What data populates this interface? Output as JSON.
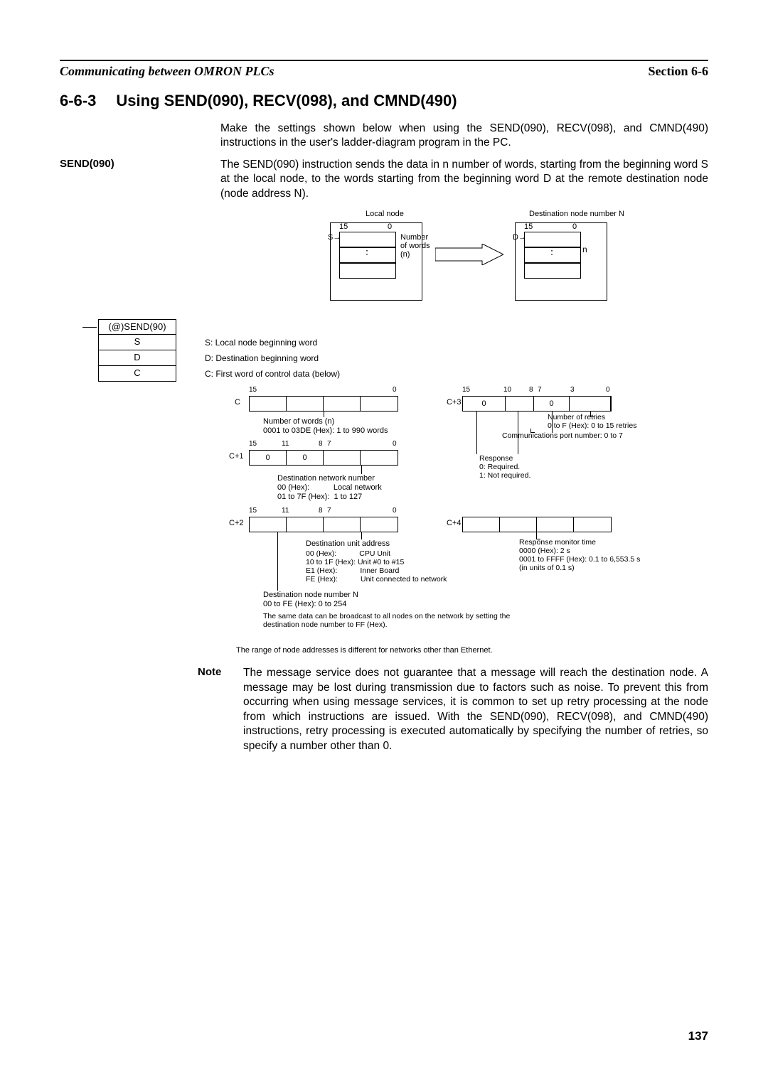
{
  "header": {
    "left": "Communicating between OMRON PLCs",
    "right": "Section 6-6"
  },
  "section": {
    "number": "6-6-3",
    "title": "Using SEND(090), RECV(098), and CMND(490)"
  },
  "intro": "Make the settings shown below when using the SEND(090), RECV(098), and CMND(490) instructions in the user's ladder-diagram program in the PC.",
  "send": {
    "label": "SEND(090)",
    "text": "The SEND(090) instruction sends the data in n number of words, starting from the beginning word S at the local node, to the words starting from the beginning word D at the remote destination node (node address N)."
  },
  "fig1": {
    "local": "Local node",
    "dest": "Destination node number N",
    "bit15": "15",
    "bit0": "0",
    "Sarrow": "S→",
    "Darrow": "D→",
    "numwords": "Number of words (n)",
    "n": "n"
  },
  "ladder": {
    "title": "(@)SEND(90)",
    "rows": [
      "S",
      "D",
      "C"
    ],
    "descs": [
      "S: Local node beginning word",
      "D: Destination beginning word",
      "C: First word of control data (below)"
    ]
  },
  "ctrl": {
    "C": {
      "lbl": "C",
      "t15": "15",
      "t0": "0",
      "ann": "Number of words (n)\n0001 to 03DE (Hex): 1 to 990 words"
    },
    "C1": {
      "lbl": "C+1",
      "t15": "15",
      "t11": "11",
      "t8": "8",
      "t7": "7",
      "t0": "0",
      "zeros": [
        "0",
        "0"
      ],
      "ann": "Destination network number\n00 (Hex):           Local network\n01 to 7F (Hex):  1 to 127"
    },
    "C2": {
      "lbl": "C+2",
      "t15": "15",
      "t11": "11",
      "t8": "8",
      "t7": "7",
      "t0": "0",
      "annUnit": "Destination unit address",
      "unitLines": "00 (Hex):           CPU Unit\n10 to 1F (Hex): Unit #0 to #15\nE1 (Hex):           Inner Board\nFE (Hex):           Unit connected to network",
      "annNode": "Destination node number N\n00 to FE (Hex): 0 to 254",
      "bcast": "The same data can be broadcast to all nodes on the network by setting the destination node number to FF (Hex)."
    },
    "C3": {
      "lbl": "C+3",
      "t15": "15",
      "t10": "10",
      "t8": "8",
      "t7": "7",
      "t3": "3",
      "t0": "0",
      "zeros": [
        "0",
        "0"
      ],
      "retry": "Number of retries\n0 to F (Hex): 0 to 15 retries",
      "port": "Communications port number: 0 to 7",
      "resp": "Response\n0: Required.\n1: Not required."
    },
    "C4": {
      "lbl": "C+4",
      "ann": "Response monitor time\n0000 (Hex): 2 s\n0001 to FFFF (Hex): 0.1 to 6,553.5 s\n(in units of 0.1 s)"
    }
  },
  "rangeNote": "The range of node addresses is different for networks other than Ethernet.",
  "note": {
    "label": "Note",
    "text": "The message service does not guarantee that a message will reach the destination node. A message may be lost during transmission due to factors such as noise. To prevent this from occurring when using message services, it is common to set up retry processing at the node from which instructions are issued. With the SEND(090), RECV(098), and CMND(490) instructions, retry processing is executed automatically by specifying the number of retries, so specify a number other than 0."
  },
  "page": "137"
}
